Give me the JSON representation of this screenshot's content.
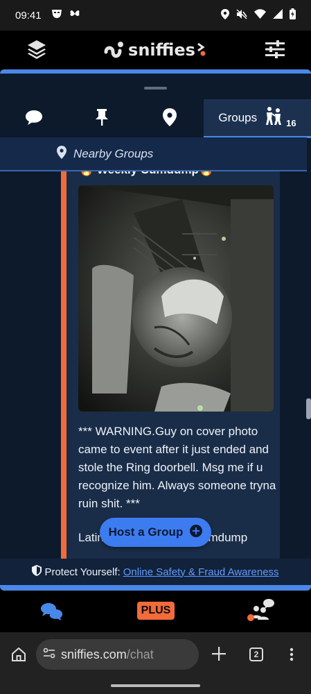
{
  "status_bar": {
    "time": "09:41",
    "left_icons": [
      "grindr-mask-icon",
      "butterfly-icon"
    ],
    "right_icons": [
      "location-icon",
      "mute-icon",
      "wifi-icon",
      "signal-icon",
      "battery-icon"
    ]
  },
  "header": {
    "logo_text": "sniffies",
    "left_icon": "layers-icon",
    "right_icon": "filter-sliders-icon"
  },
  "tabs": [
    {
      "icon": "chat-bubble-icon",
      "label": ""
    },
    {
      "icon": "pin-icon",
      "label": ""
    },
    {
      "icon": "map-marker-icon",
      "label": ""
    },
    {
      "icon": "group-people-icon",
      "label": "Groups",
      "count": "16",
      "active": true
    }
  ],
  "nearby": {
    "icon": "map-marker-icon",
    "label": "Nearby Groups"
  },
  "card": {
    "title": "🔥 Weekly Cumdump🔥",
    "description": "*** WARNING.Guy on cover photo came to event after it just ended and stole the Ring doorbell. Msg me if u recognize him. Always someone tryna ruin shit. ***",
    "description_second": "Latino mase mase 🍆 cumdump"
  },
  "host_button": {
    "label": "Host a Group",
    "icon": "plus-circle-icon"
  },
  "protect": {
    "icon": "shield-icon",
    "text": "Protect Yourself:",
    "link": "Online Safety & Fraud Awareness"
  },
  "bottom_nav": {
    "chat_icon": "chat-bubbles-icon",
    "plus_label": "PLUS",
    "group_icon": "group-chat-icon"
  },
  "browser": {
    "url_prefix": "sniffies.com",
    "url_path": "/chat",
    "tab_count": "2"
  },
  "colors": {
    "accent_blue": "#4a88e8",
    "accent_orange": "#f26b3a",
    "panel_bg": "#0d1a2c"
  }
}
